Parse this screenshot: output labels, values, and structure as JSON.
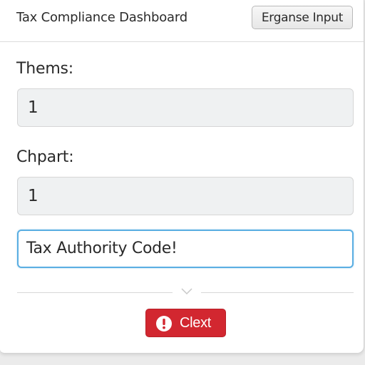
{
  "header": {
    "title": "Tax Compliance Dashboard",
    "button_label": "Erganse Input"
  },
  "form": {
    "fields": [
      {
        "label": "Thems:",
        "value": "1"
      },
      {
        "label": "Chpart:",
        "value": "1"
      }
    ],
    "active_input": {
      "value": "Tax Authority Code!"
    }
  },
  "actions": {
    "error_button_label": "Clext",
    "error_button_icon": "exclamation-circle-icon",
    "divider_icon": "chevron-down-icon"
  },
  "colors": {
    "accent_focus": "#5aaee2",
    "danger": "#d22730"
  }
}
